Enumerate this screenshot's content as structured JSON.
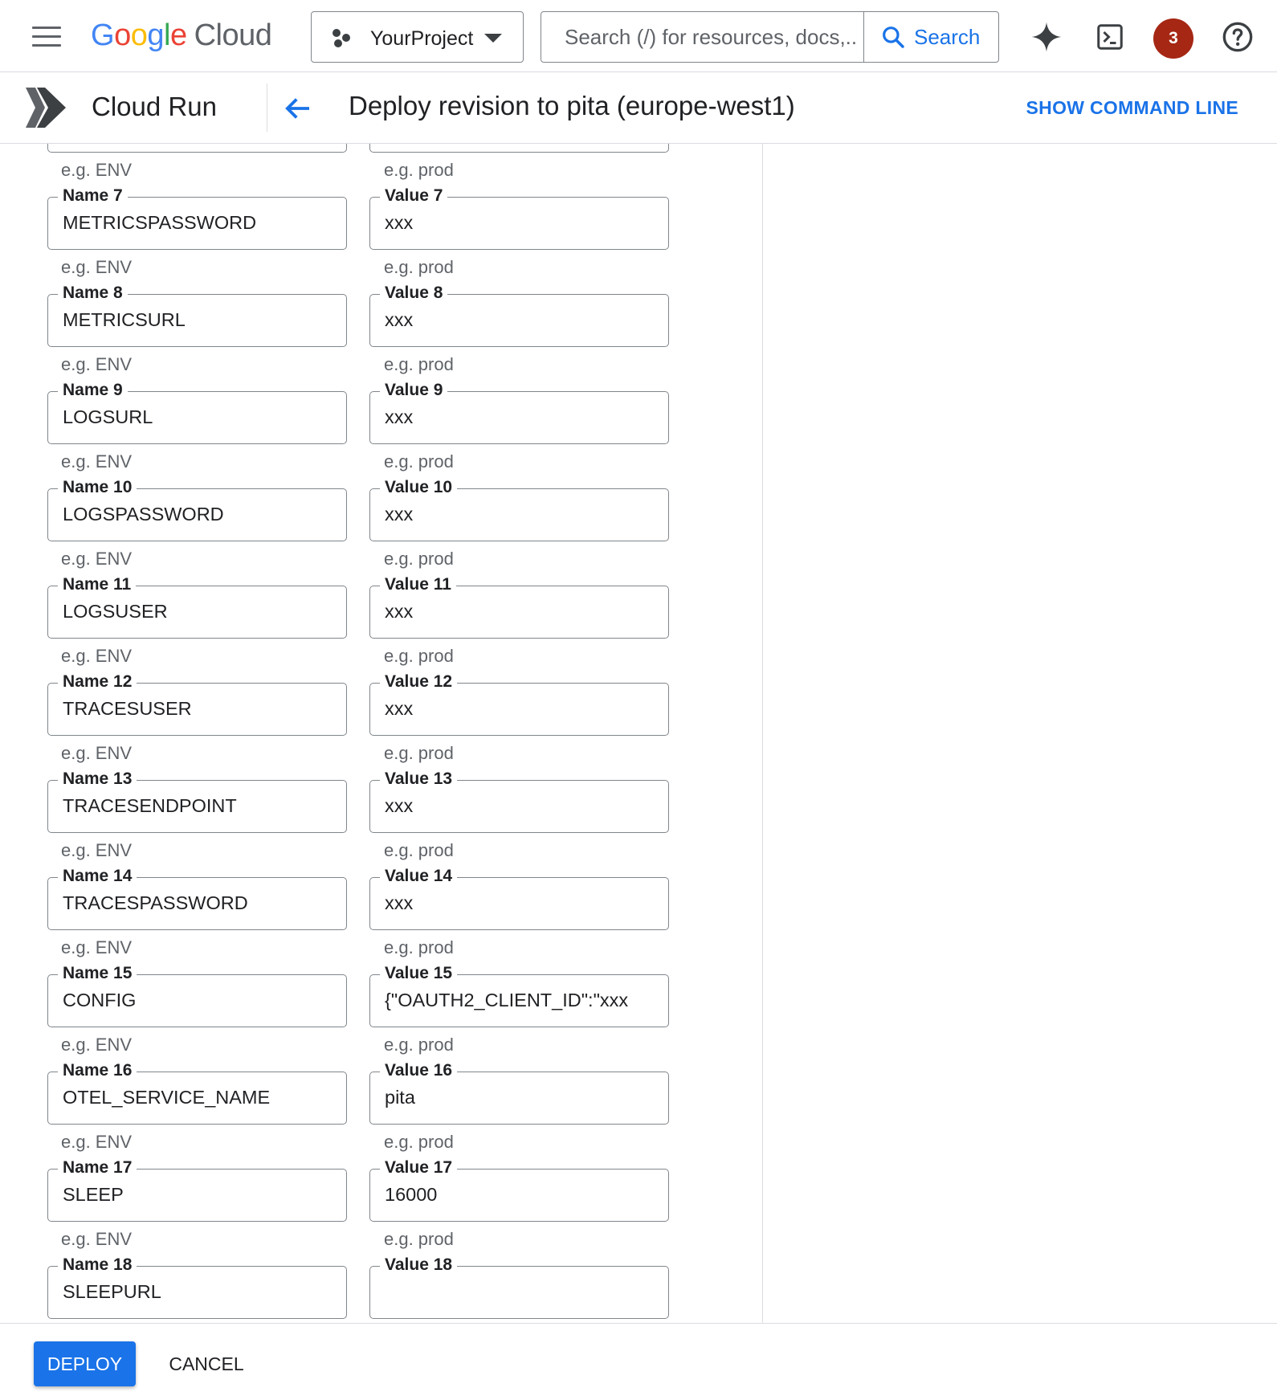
{
  "topbar": {
    "brand_letters": [
      "G",
      "o",
      "o",
      "g",
      "l",
      "e"
    ],
    "brand_cloud": "Cloud",
    "project_name": "YourProject",
    "search_placeholder": "Search (/) for resources, docs,..",
    "search_button": "Search",
    "notifications_count": "3",
    "icons": [
      "menu-icon",
      "gemini-sparkle-icon",
      "cloud-shell-icon",
      "help-icon"
    ]
  },
  "subheader": {
    "product": "Cloud Run",
    "title": "Deploy revision to pita (europe-west1)",
    "show_command_line": "SHOW COMMAND LINE"
  },
  "env_vars": {
    "name_hint": "e.g. ENV",
    "value_hint": "e.g. prod",
    "rows": [
      {
        "name_label": "Name 7",
        "name": "METRICSPASSWORD",
        "value_label": "Value 7",
        "value": "xxx"
      },
      {
        "name_label": "Name 8",
        "name": "METRICSURL",
        "value_label": "Value 8",
        "value": "xxx"
      },
      {
        "name_label": "Name 9",
        "name": "LOGSURL",
        "value_label": "Value 9",
        "value": "xxx"
      },
      {
        "name_label": "Name 10",
        "name": "LOGSPASSWORD",
        "value_label": "Value 10",
        "value": "xxx"
      },
      {
        "name_label": "Name 11",
        "name": "LOGSUSER",
        "value_label": "Value 11",
        "value": "xxx"
      },
      {
        "name_label": "Name 12",
        "name": "TRACESUSER",
        "value_label": "Value 12",
        "value": "xxx"
      },
      {
        "name_label": "Name 13",
        "name": "TRACESENDPOINT",
        "value_label": "Value 13",
        "value": "xxx"
      },
      {
        "name_label": "Name 14",
        "name": "TRACESPASSWORD",
        "value_label": "Value 14",
        "value": "xxx"
      },
      {
        "name_label": "Name 15",
        "name": "CONFIG",
        "value_label": "Value 15",
        "value": "{\"OAUTH2_CLIENT_ID\":\"xxx"
      },
      {
        "name_label": "Name 16",
        "name": "OTEL_SERVICE_NAME",
        "value_label": "Value 16",
        "value": "pita"
      },
      {
        "name_label": "Name 17",
        "name": "SLEEP",
        "value_label": "Value 17",
        "value": "16000"
      },
      {
        "name_label": "Name 18",
        "name": "SLEEPURL",
        "value_label": "Value 18",
        "value": ""
      }
    ]
  },
  "footer": {
    "deploy": "DEPLOY",
    "cancel": "CANCEL"
  }
}
